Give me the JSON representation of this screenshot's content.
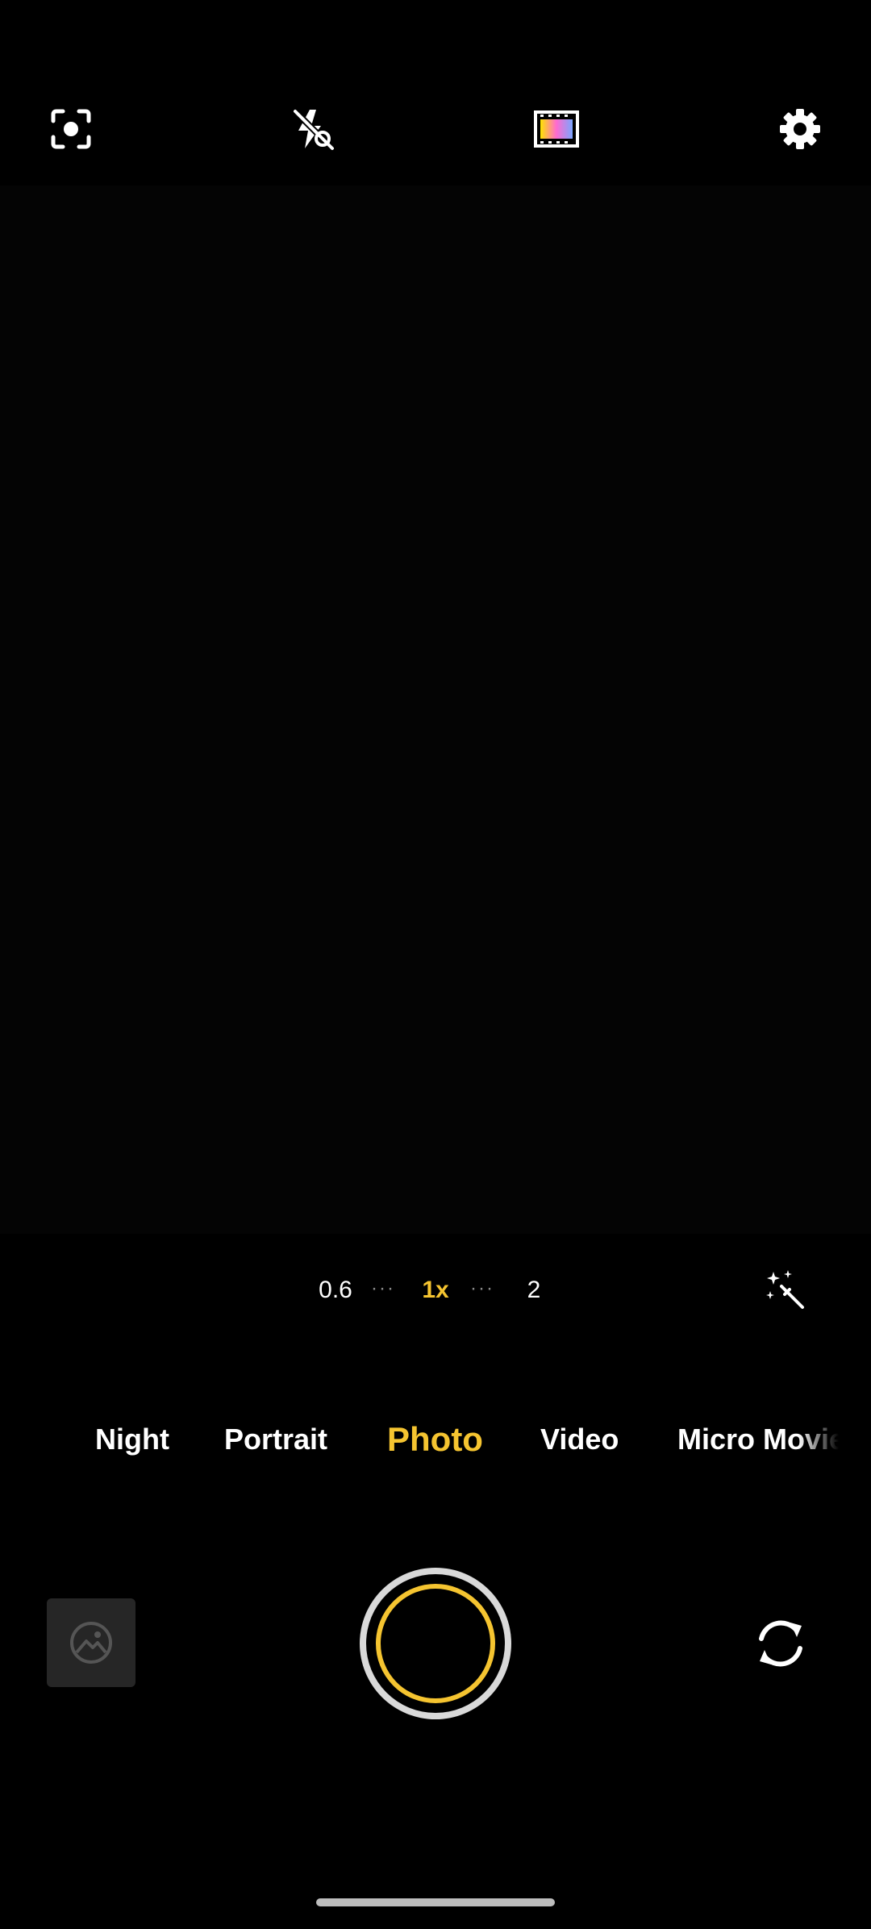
{
  "top_bar": {
    "icons": [
      "lens-scan-icon",
      "flash-off-icon",
      "color-filter-icon",
      "settings-gear-icon"
    ]
  },
  "zoom": {
    "options": [
      "0.6",
      "1x",
      "2"
    ],
    "selected": "1x",
    "separator": "···"
  },
  "modes": {
    "items": [
      "Night",
      "Portrait",
      "Photo",
      "Video",
      "Micro Movie"
    ],
    "selected": "Photo"
  },
  "colors": {
    "accent": "#f5c430",
    "background": "#000000",
    "text": "#ffffff"
  }
}
